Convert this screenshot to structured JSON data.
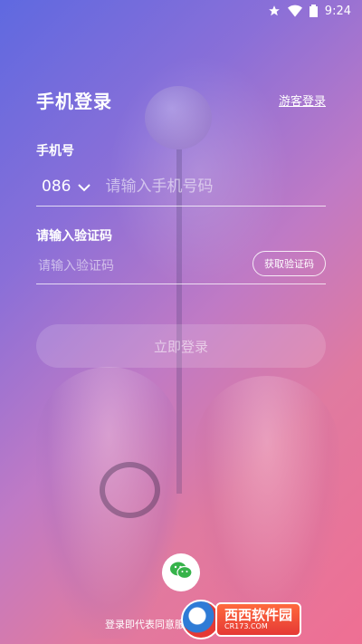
{
  "status_bar": {
    "time": "9:24"
  },
  "header": {
    "title": "手机登录",
    "guest_login": "游客登录"
  },
  "phone": {
    "label": "手机号",
    "country_code": "086",
    "placeholder": "请输入手机号码"
  },
  "code": {
    "label": "请输入验证码",
    "placeholder": "请输入验证码",
    "get_code_button": "获取验证码"
  },
  "login_button": "立即登录",
  "footer": {
    "agreement_text": "登录即代表同意服务协议",
    "wechat_icon": "wechat-icon"
  },
  "watermark": {
    "brand": "西西软件园",
    "url": "CR173.COM"
  }
}
